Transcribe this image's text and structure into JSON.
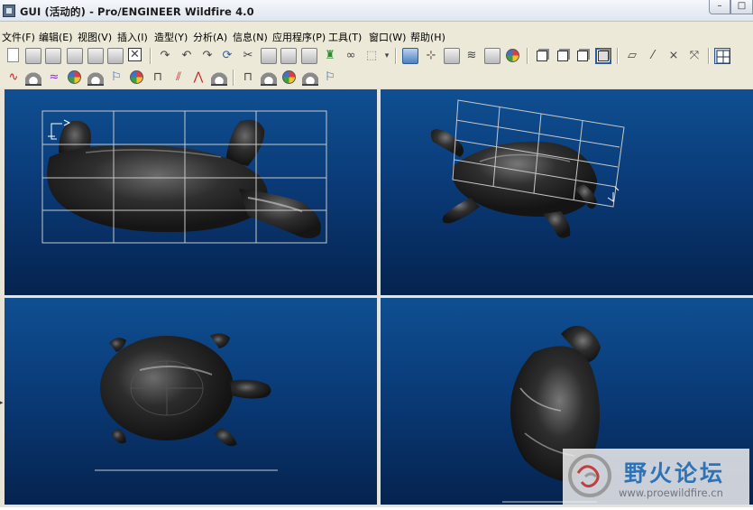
{
  "window": {
    "title": "GUI (活动的) - Pro/ENGINEER Wildfire 4.0",
    "minimize_glyph": "–",
    "maximize_glyph": "□"
  },
  "menubar": [
    {
      "id": "file",
      "label": "文件(F)"
    },
    {
      "id": "edit",
      "label": "编辑(E)"
    },
    {
      "id": "view",
      "label": "视图(V)"
    },
    {
      "id": "insert",
      "label": "插入(I)"
    },
    {
      "id": "modeling",
      "label": "造型(Y)"
    },
    {
      "id": "analysis",
      "label": "分析(A)"
    },
    {
      "id": "info",
      "label": "信息(N)"
    },
    {
      "id": "applications",
      "label": "应用程序(P)"
    },
    {
      "id": "tools",
      "label": "工具(T)"
    },
    {
      "id": "window",
      "label": "窗口(W)"
    },
    {
      "id": "help",
      "label": "帮助(H)"
    }
  ],
  "toolbar_icons": {
    "row1": [
      "new-icon",
      "open-icon",
      "save-icon",
      "print-icon",
      "email-icon",
      "send-icon",
      "close-window-icon",
      "regenerate-icon",
      "undo-icon",
      "redo-icon",
      "refresh-icon",
      "cut-icon",
      "copy-icon",
      "paste-icon",
      "paste-special-icon",
      "find-icon",
      "binoculars-icon",
      "select-box-icon",
      "repaint-icon",
      "spin-center-icon",
      "orient-icon",
      "layers-icon",
      "saved-views-icon",
      "appearance-icon",
      "wireframe-icon",
      "hidden-line-icon",
      "no-hidden-icon",
      "shading-icon",
      "datum-plane-icon",
      "datum-axis-icon",
      "datum-point-icon",
      "coordinate-system-icon",
      "four-view-icon"
    ],
    "row2": [
      "curve-icon",
      "surface-icon",
      "curve-from-surface-icon",
      "style-surface-icon",
      "trim-icon",
      "analysis-curvature-icon",
      "analysis-reflection-icon",
      "analysis-dihedral-icon",
      "analysis-draft-icon",
      "analysis-slope-icon",
      "analysis-offset-icon",
      "analysis-section-icon",
      "analysis-deviation-icon",
      "analysis-shade-icon",
      "analysis-connect-icon",
      "analysis-saved-icon"
    ]
  },
  "viewports": [
    {
      "id": "top-left",
      "view": "front",
      "grid": true
    },
    {
      "id": "top-right",
      "view": "isometric",
      "grid": true
    },
    {
      "id": "bottom-left",
      "view": "top",
      "grid": false
    },
    {
      "id": "bottom-right",
      "view": "right",
      "grid": false
    }
  ],
  "colors": {
    "viewport_top": "#0f4f92",
    "viewport_bottom": "#05234f",
    "model": "#2a2a2a",
    "grid": "#c8c8c8"
  },
  "watermark": {
    "title": "野火论坛",
    "url": "www.proewildfire.cn"
  }
}
